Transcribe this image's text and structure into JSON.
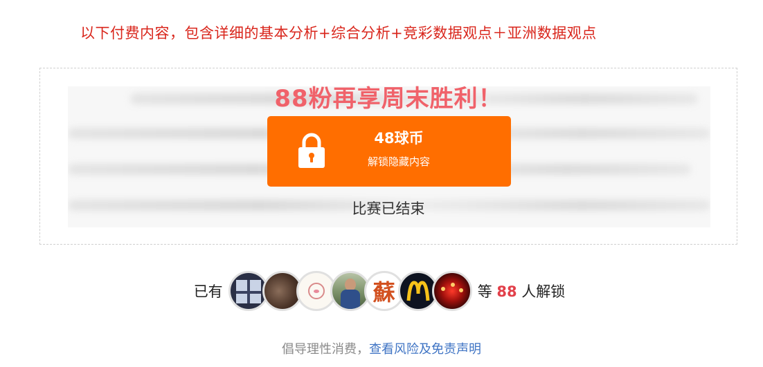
{
  "notice": "以下付费内容，包含详细的基本分析+综合分析+竞彩数据观点＋亚洲数据观点",
  "paywall": {
    "promo": "88粉再享周末胜利！",
    "price": "48球币",
    "unlock_label": "解锁隐藏内容",
    "status": "比赛已结束",
    "icon": "lock-icon"
  },
  "unlockers": {
    "prefix": "已有",
    "suffix_before": "等",
    "count": "88",
    "suffix_after": "人解锁",
    "avatars": [
      "avatar-1",
      "avatar-2",
      "avatar-3",
      "avatar-4",
      "avatar-5",
      "avatar-6",
      "avatar-7"
    ],
    "avatar_glyph": "蘇"
  },
  "footer": {
    "text": "倡导理性消费，",
    "link": "查看风险及免责声明"
  },
  "colors": {
    "accent": "#ff6e00",
    "notice": "#d9261c",
    "promo": "#f0626a",
    "count": "#e2404a",
    "link": "#3f74c4"
  }
}
